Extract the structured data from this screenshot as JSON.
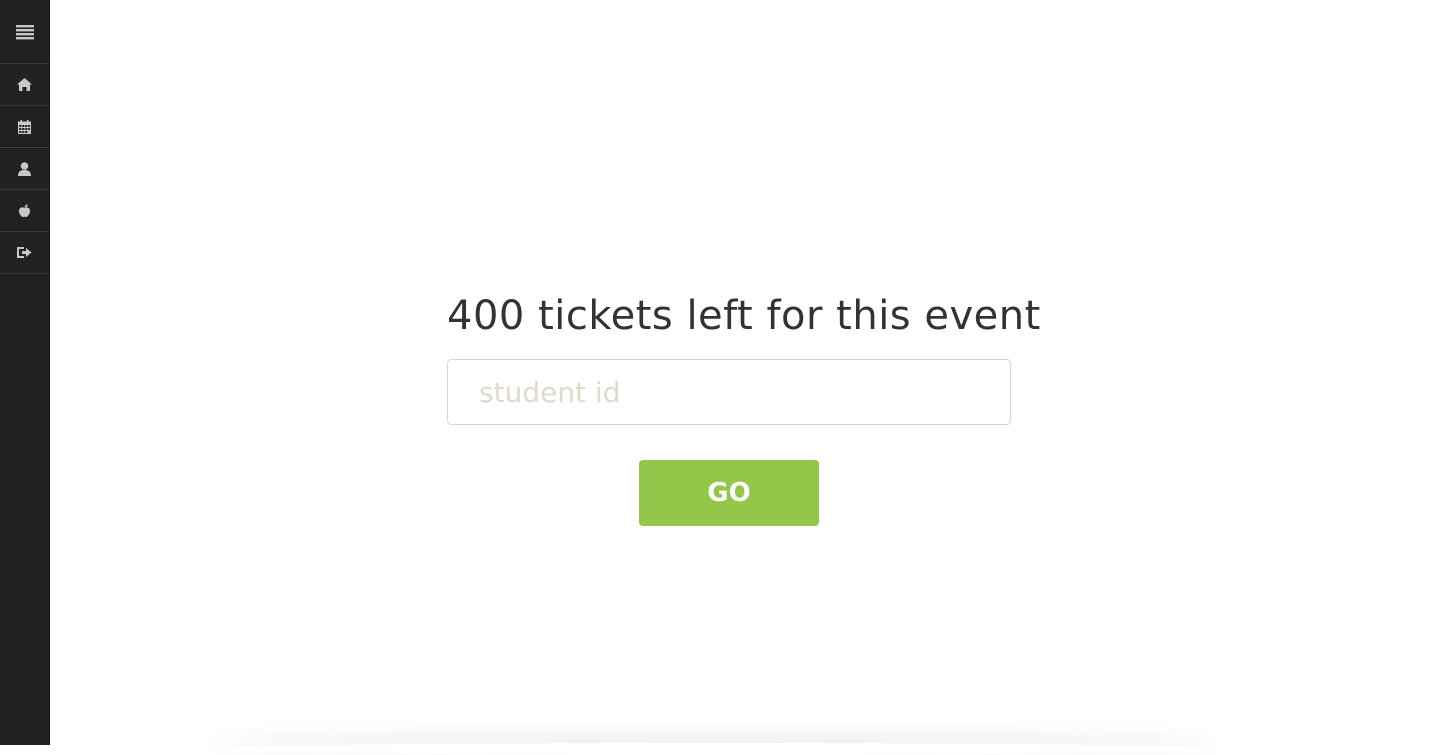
{
  "sidebar": {
    "toggle_icon": "menu-icon",
    "items": [
      {
        "name": "home",
        "icon": "home-icon"
      },
      {
        "name": "calendar",
        "icon": "calendar-icon"
      },
      {
        "name": "profile",
        "icon": "user-icon"
      },
      {
        "name": "apple",
        "icon": "apple-icon"
      },
      {
        "name": "logout",
        "icon": "logout-icon"
      }
    ],
    "colors": {
      "background": "#222222",
      "icon": "#c8c8c8",
      "divider": "#3a3a3a"
    }
  },
  "main": {
    "heading": "400 tickets left for this event",
    "tickets_left": 400,
    "student_id_input": {
      "value": "",
      "placeholder": "student id"
    },
    "go_button_label": "GO",
    "colors": {
      "accent": "#94c64a",
      "heading": "#333333",
      "placeholder": "#e1d9cc"
    }
  }
}
